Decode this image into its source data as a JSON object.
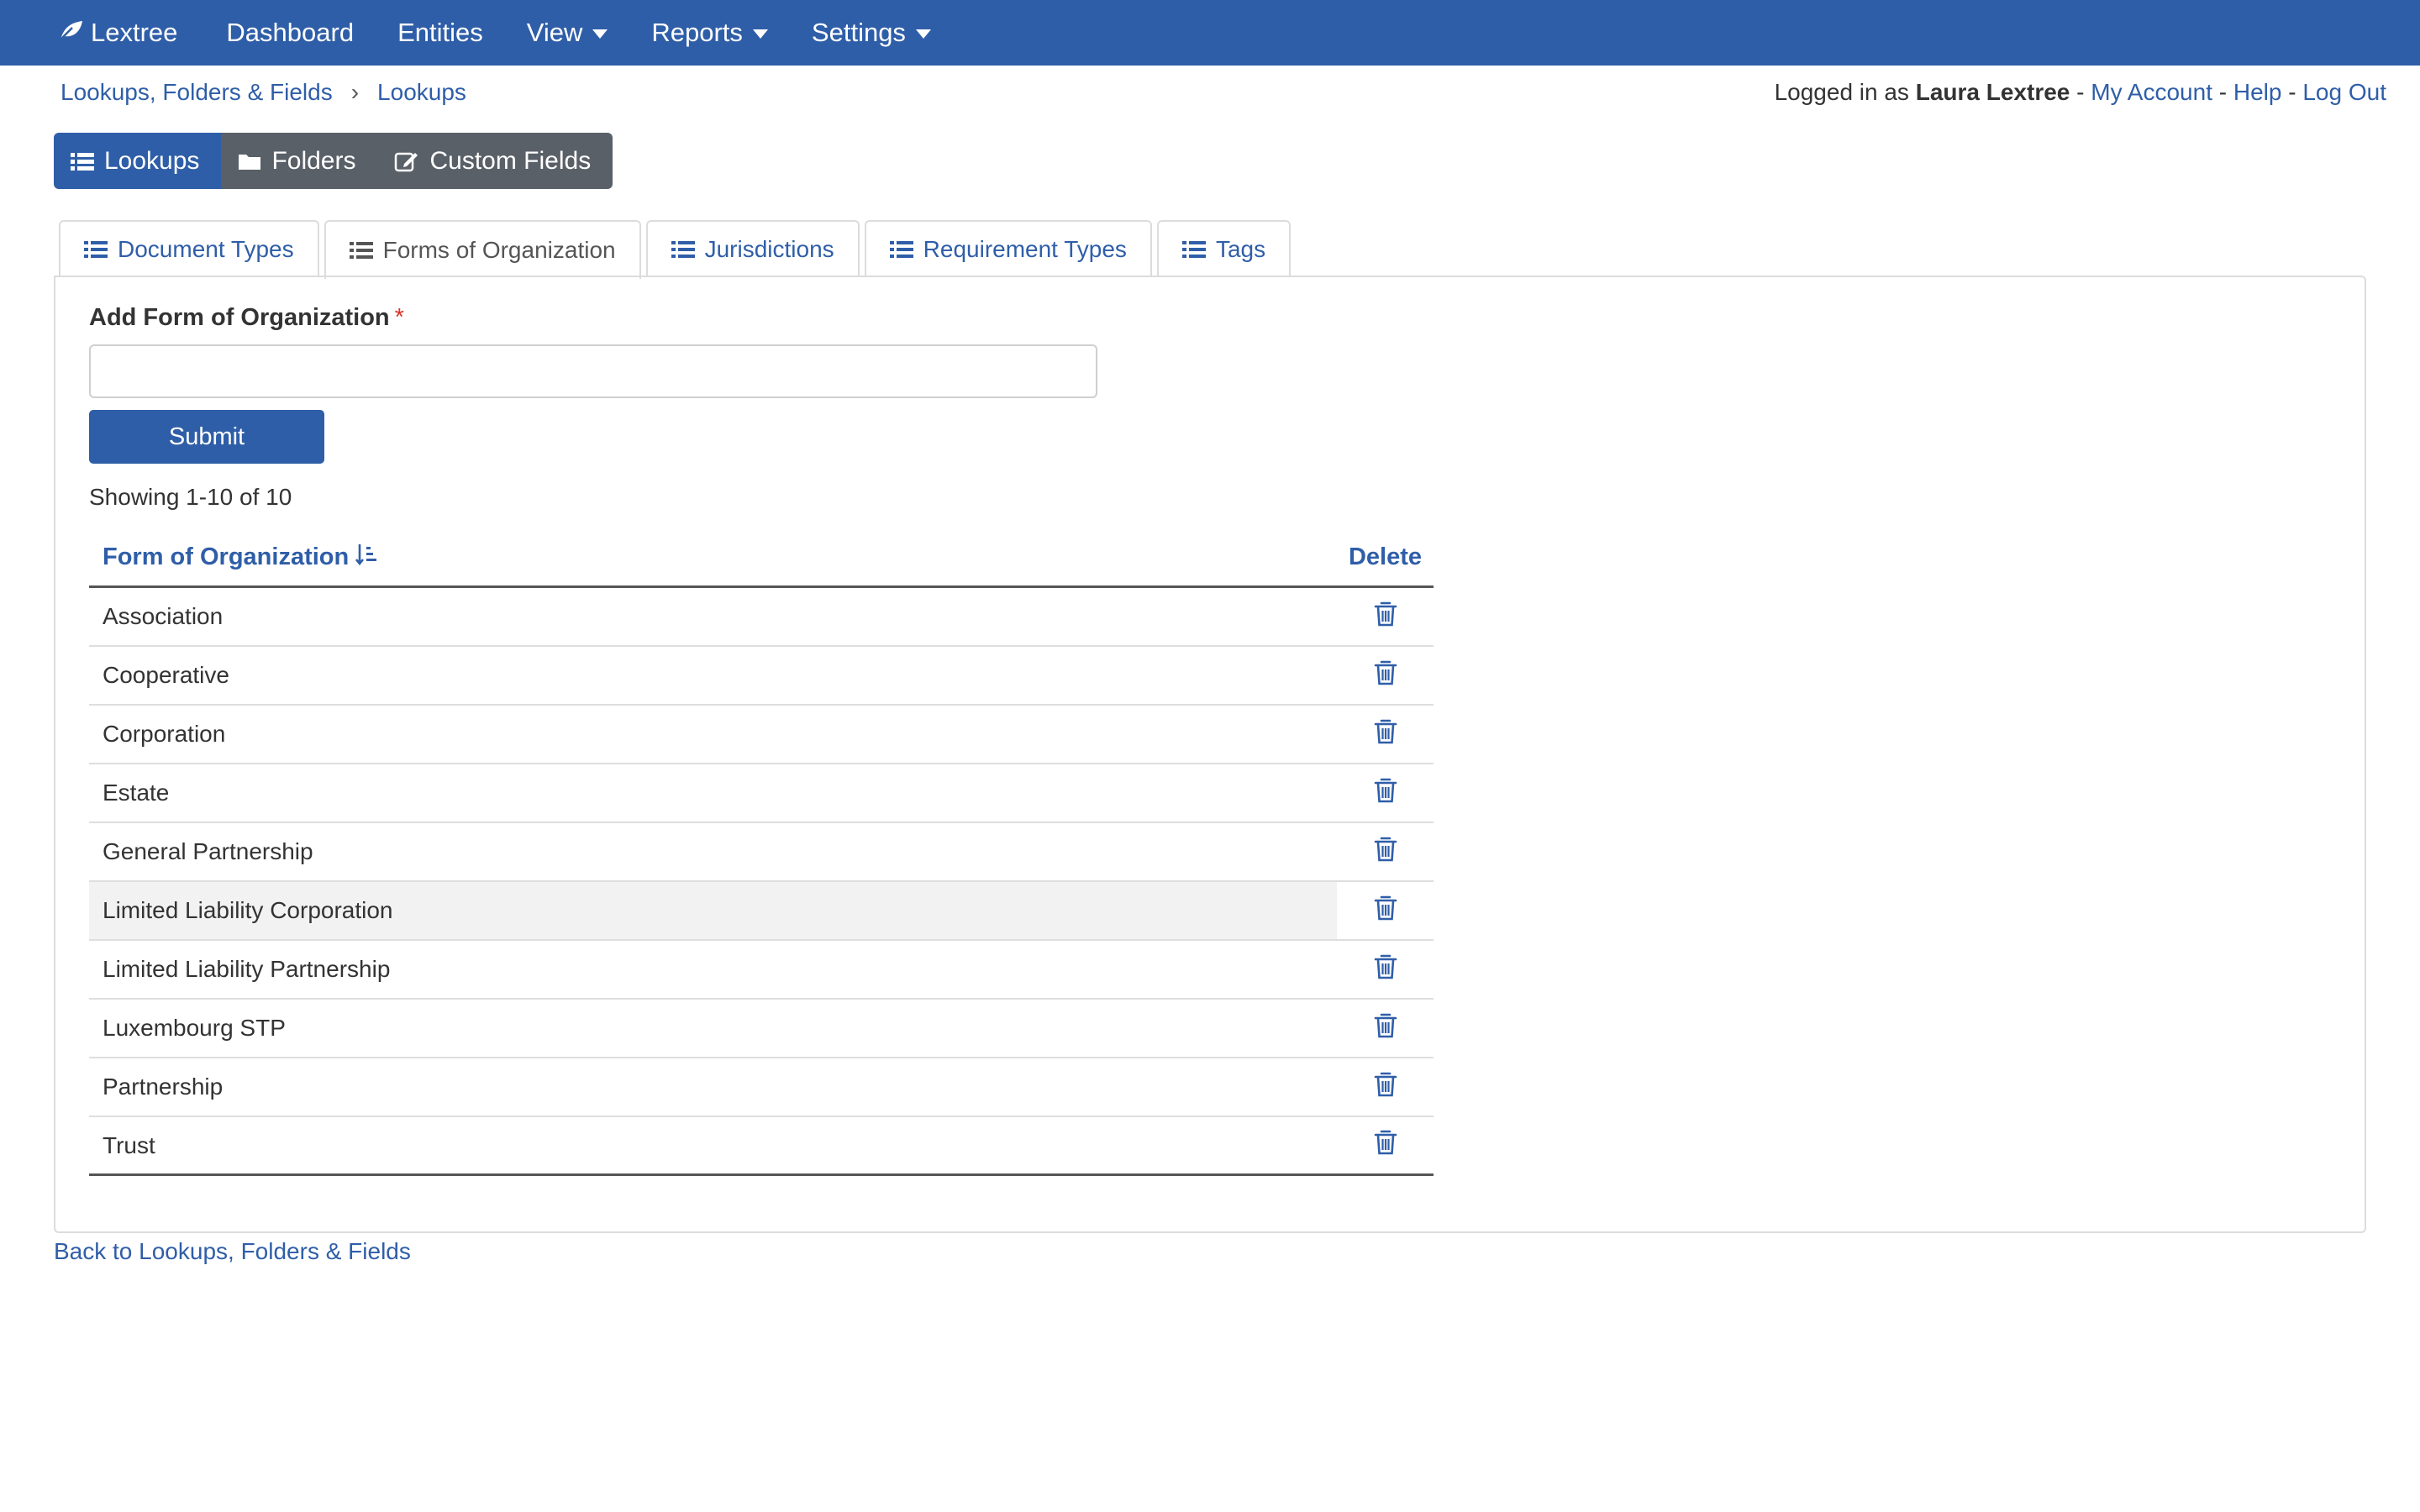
{
  "nav": {
    "brand": "Lextree",
    "items": [
      {
        "label": "Dashboard",
        "dropdown": false
      },
      {
        "label": "Entities",
        "dropdown": false
      },
      {
        "label": "View",
        "dropdown": true
      },
      {
        "label": "Reports",
        "dropdown": true
      },
      {
        "label": "Settings",
        "dropdown": true
      }
    ]
  },
  "breadcrumb": {
    "parent": "Lookups, Folders & Fields",
    "separator": "›",
    "current": "Lookups"
  },
  "account": {
    "prefix": "Logged in as",
    "user": "Laura Lextree",
    "sep": "-",
    "my_account": "My Account",
    "help": "Help",
    "logout": "Log Out"
  },
  "segments": [
    {
      "label": "Lookups",
      "icon": "list-icon",
      "active": true
    },
    {
      "label": "Folders",
      "icon": "folder-icon",
      "active": false
    },
    {
      "label": "Custom Fields",
      "icon": "edit-icon",
      "active": false
    }
  ],
  "tabs": [
    {
      "label": "Document Types",
      "active": false
    },
    {
      "label": "Forms of Organization",
      "active": true
    },
    {
      "label": "Jurisdictions",
      "active": false
    },
    {
      "label": "Requirement Types",
      "active": false
    },
    {
      "label": "Tags",
      "active": false
    }
  ],
  "form": {
    "label": "Add Form of Organization",
    "required_mark": "*",
    "input_value": "",
    "submit_label": "Submit"
  },
  "showing": "Showing 1-10 of 10",
  "table": {
    "col_name": "Form of Organization",
    "col_delete": "Delete",
    "rows": [
      "Association",
      "Cooperative",
      "Corporation",
      "Estate",
      "General Partnership",
      "Limited Liability Corporation",
      "Limited Liability Partnership",
      "Luxembourg STP",
      "Partnership",
      "Trust"
    ],
    "hovered_row": "Limited Liability Corporation"
  },
  "back_link": "Back to Lookups, Folders & Fields",
  "colors": {
    "primary": "#2f5ea8",
    "secondary": "#5a6068"
  }
}
